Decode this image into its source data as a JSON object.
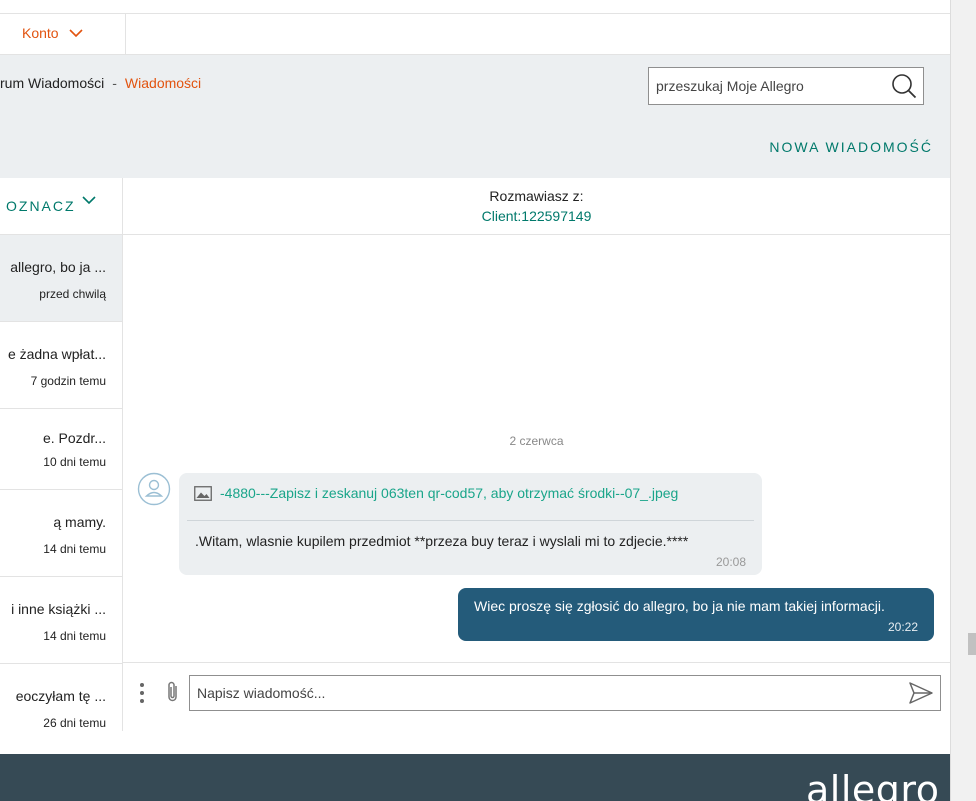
{
  "topbar": {
    "account_label": "Konto"
  },
  "header": {
    "breadcrumb_parent": "rum Wiadomości",
    "breadcrumb_separator": "-",
    "breadcrumb_current": "Wiadomości",
    "search_placeholder": "przeszukaj Moje Allegro",
    "new_message_label": "NOWA WIADOMOŚĆ"
  },
  "conversation_list": {
    "select_label": "OZNACZ",
    "items": [
      {
        "snippet": "allegro, bo ja ...",
        "time": "przed chwilą",
        "active": true
      },
      {
        "snippet": "e żadna wpłat...",
        "time": "7 godzin temu",
        "active": false
      },
      {
        "snippet": "e. Pozdr...",
        "time": "10 dni temu",
        "active": false
      },
      {
        "snippet": "ą mamy.",
        "time": "14 dni temu",
        "active": false
      },
      {
        "snippet": "i inne książki ...",
        "time": "14 dni temu",
        "active": false
      },
      {
        "snippet": "eoczyłam tę ...",
        "time": "26 dni temu",
        "active": false
      }
    ]
  },
  "chat": {
    "talking_label": "Rozmawiasz z:",
    "client_name": "Client:122597149",
    "date_separator": "2 czerwca",
    "incoming": {
      "attachment_name": "-4880---Zapisz i zeskanuj 063ten qr-cod57, aby otrzymać środki--07_.jpeg",
      "text": ".Witam, wlasnie kupilem przedmiot **przeza buy teraz i wyslali mi to zdjecie.****",
      "time": "20:08"
    },
    "outgoing": {
      "text": "Wiec proszę się zgłosić do allegro, bo ja nie mam takiej informacji.",
      "time": "20:22"
    },
    "composer_placeholder": "Napisz wiadomość..."
  },
  "footer": {
    "logo_text": "allegro"
  },
  "colors": {
    "accent_orange": "#e2530f",
    "teal": "#00796b",
    "outgoing_bubble": "#245b7a",
    "incoming_bubble": "#eceff1",
    "footer_bg": "#364a55"
  },
  "icons": [
    "chevron-down-icon",
    "search-icon",
    "user-avatar-icon",
    "image-icon",
    "more-vertical-icon",
    "paperclip-icon",
    "send-icon"
  ]
}
